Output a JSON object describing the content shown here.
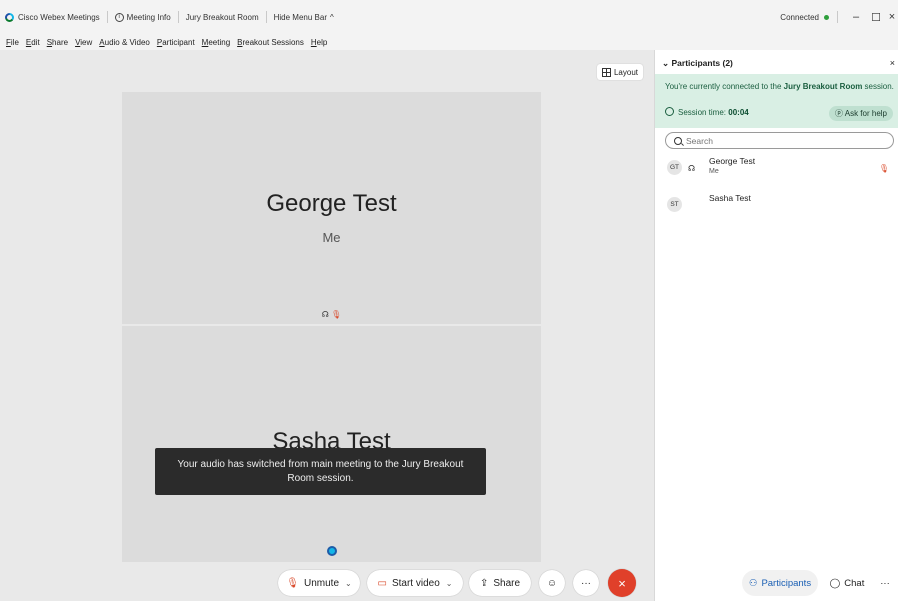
{
  "titlebar": {
    "app_name": "Cisco Webex Meetings",
    "meeting_info": "Meeting Info",
    "room_name": "Jury Breakout Room",
    "hide_menu": "Hide Menu Bar",
    "hide_menu_icon": "^",
    "connection_status": "Connected",
    "minimize": "–",
    "maximize": "☐",
    "close": "×"
  },
  "menubar": {
    "items": [
      "File",
      "Edit",
      "Share",
      "View",
      "Audio & Video",
      "Participant",
      "Meeting",
      "Breakout Sessions",
      "Help"
    ]
  },
  "stage": {
    "layout_label": "Layout",
    "tiles": [
      {
        "name": "George Test",
        "subtitle": "Me"
      },
      {
        "name": "Sasha Test"
      }
    ],
    "toast": "Your audio has switched from main meeting to the Jury Breakout Room session."
  },
  "controls": {
    "unmute": "Unmute",
    "start_video": "Start video",
    "share": "Share",
    "more": "···",
    "end": "×",
    "chevron": "⌄"
  },
  "panel": {
    "title": "Participants (2)",
    "close": "×",
    "banner_prefix": "You're currently connected to the ",
    "banner_room": "Jury Breakout Room",
    "banner_suffix": " session.",
    "session_label": "Session time: ",
    "session_time": "00:04",
    "ask_help": "Ask for help",
    "search_placeholder": "Search",
    "participants": [
      {
        "initials": "GT",
        "name": "George Test",
        "note": "Me"
      },
      {
        "initials": "ST",
        "name": "Sasha Test"
      }
    ],
    "footer": {
      "participants": "Participants",
      "chat": "Chat",
      "more": "···"
    }
  },
  "colors": {
    "accent_green": "#2e9f3c",
    "end_red": "#e0402a",
    "banner_bg": "#d9efe4",
    "mic_muted": "#d9492a"
  },
  "icons": {
    "app": "webex-logo-icon",
    "info": "info-icon",
    "layout": "grid-icon",
    "mic": "mic-muted-icon",
    "video": "video-off-icon",
    "share": "share-icon",
    "reactions": "smiley-icon",
    "headset": "headset-icon",
    "search": "search-icon",
    "clock": "clock-icon",
    "help": "help-icon",
    "participants": "participants-icon",
    "chat": "chat-icon"
  }
}
